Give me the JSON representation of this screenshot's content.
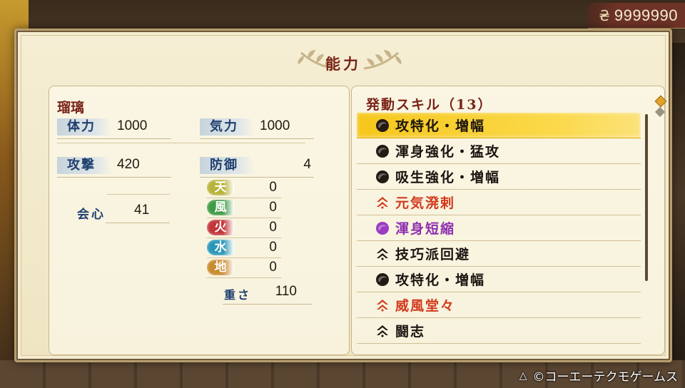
{
  "currency": {
    "icon": "coin-icon",
    "amount": "9999990"
  },
  "screen": {
    "title": "能力"
  },
  "character": {
    "name": "瑠璃"
  },
  "stats": {
    "hp_label": "体力",
    "hp_value": "1000",
    "ki_label": "気力",
    "ki_value": "1000",
    "attack_label": "攻撃",
    "attack_value": "420",
    "defense_label": "防御",
    "defense_value": "4",
    "crit_label": "会心",
    "crit_value": "41",
    "weight_label": "重さ",
    "weight_value": "110"
  },
  "elements": [
    {
      "label": "天",
      "value": "0",
      "color": "#b8b23a"
    },
    {
      "label": "風",
      "value": "0",
      "color": "#3f9a45"
    },
    {
      "label": "火",
      "value": "0",
      "color": "#c2363a"
    },
    {
      "label": "水",
      "value": "0",
      "color": "#2a97b8"
    },
    {
      "label": "地",
      "value": "0",
      "color": "#c98a2e"
    }
  ],
  "skills": {
    "header": "発動スキル（13）",
    "items": [
      {
        "name": "攻特化・増幅",
        "icon": "dark-orb-icon",
        "color": "#1a1410",
        "selected": true
      },
      {
        "name": "渾身強化・猛攻",
        "icon": "dark-orb-icon",
        "color": "#1a1410",
        "selected": false
      },
      {
        "name": "吸生強化・増幅",
        "icon": "dark-orb-icon",
        "color": "#1a1410",
        "selected": false
      },
      {
        "name": "元気溌剌",
        "icon": "red-chevron-icon",
        "color": "#d23a1e",
        "selected": false
      },
      {
        "name": "渾身短縮",
        "icon": "purple-orb-icon",
        "color": "#8e2fb0",
        "selected": false
      },
      {
        "name": "技巧派回避",
        "icon": "black-chevron-icon",
        "color": "#1a1410",
        "selected": false
      },
      {
        "name": "攻特化・増幅",
        "icon": "dark-orb-icon",
        "color": "#1a1410",
        "selected": false
      },
      {
        "name": "威風堂々",
        "icon": "red-chevron-icon",
        "color": "#d23a1e",
        "selected": false
      },
      {
        "name": "闘志",
        "icon": "black-chevron-icon",
        "color": "#1a1410",
        "selected": false
      }
    ]
  },
  "footer": {
    "button_icon": "triangle-button-icon",
    "copyright": "©コーエーテクモゲームス"
  }
}
